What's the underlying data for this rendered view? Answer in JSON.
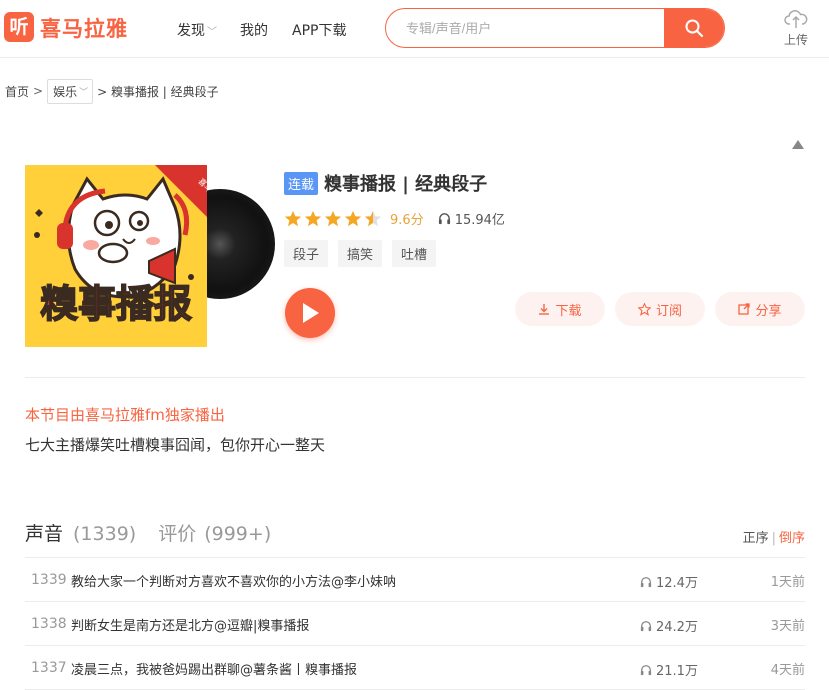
{
  "header": {
    "logo_glyph": "听",
    "logo_text": "喜马拉雅",
    "nav": [
      {
        "label": "发现",
        "has_dropdown": true
      },
      {
        "label": "我的",
        "has_dropdown": false
      },
      {
        "label": "APP下载",
        "has_dropdown": false
      }
    ],
    "search_placeholder": "专辑/声音/用户",
    "upload_label": "上传"
  },
  "breadcrumb": {
    "home": "首页",
    "sep": ">",
    "category": "娱乐",
    "current": "> 糗事播报 | 经典段子"
  },
  "album": {
    "cover_title": "糗事播报",
    "badge": "连载",
    "title": "糗事播报 | 经典段子",
    "rating_stars": 4.5,
    "score": "9.6分",
    "plays": "15.94亿",
    "tags": [
      "段子",
      "搞笑",
      "吐槽"
    ],
    "actions": [
      {
        "label": "下载",
        "icon": "download-icon"
      },
      {
        "label": "订阅",
        "icon": "star-icon"
      },
      {
        "label": "分享",
        "icon": "share-icon"
      }
    ],
    "exclusive": "本节目由喜马拉雅fm独家播出",
    "description": "七大主播爆笑吐槽糗事囧闻，包你开心一整天"
  },
  "tabs": {
    "sounds_label": "声音",
    "sounds_count": "(1339)",
    "reviews_label": "评价",
    "reviews_count": "(999+)",
    "order_asc": "正序",
    "order_sep": "|",
    "order_desc": "倒序"
  },
  "tracks": [
    {
      "num": "1339",
      "title": "教给大家一个判断对方喜欢不喜欢你的小方法@李小妹呐",
      "plays": "12.4万",
      "time": "1天前"
    },
    {
      "num": "1338",
      "title": "判断女生是南方还是北方@逗瓣|糗事播报",
      "plays": "24.2万",
      "time": "3天前"
    },
    {
      "num": "1337",
      "title": "凌晨三点，我被爸妈踢出群聊@薯条酱丨糗事播报",
      "plays": "21.1万",
      "time": "4天前"
    }
  ],
  "colors": {
    "brand": "#f86442",
    "badge": "#5a96f5",
    "cover_bg": "#ffd03a"
  }
}
